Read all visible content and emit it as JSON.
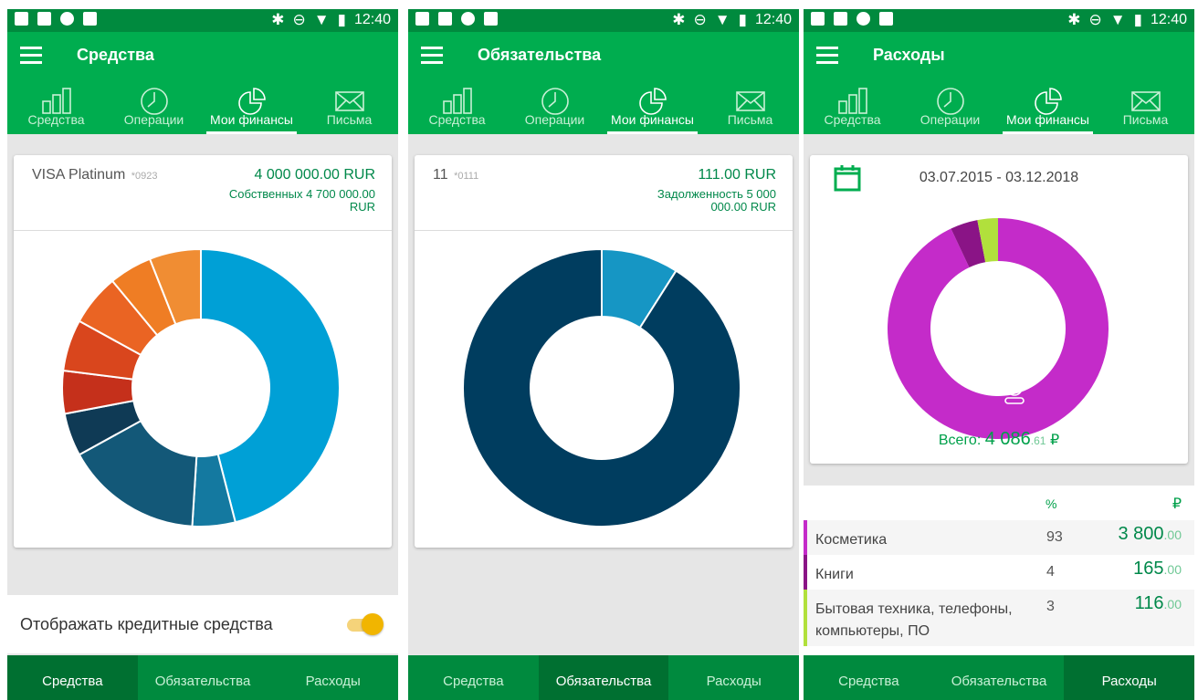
{
  "status_bar": {
    "time": "12:40"
  },
  "tabs": [
    "Средства",
    "Операции",
    "Мои финансы",
    "Письма"
  ],
  "bottom_nav": [
    "Средства",
    "Обязательства",
    "Расходы"
  ],
  "screens": {
    "assets": {
      "title": "Средства",
      "account": {
        "name": "VISA Platinum",
        "mask": "*0923",
        "amount": "4 000 000.00 RUR",
        "sub": "Собственных 4 700 000.00 RUR"
      },
      "toggle_label": "Отображать кредитные средства",
      "toggle_on": true
    },
    "liabilities": {
      "title": "Обязательства",
      "account": {
        "name": "11",
        "mask": "*0111",
        "amount": "111.00 RUR",
        "sub": "Задолженность 5 000 000.00 RUR"
      }
    },
    "expenses": {
      "title": "Расходы",
      "period": "03.07.2015 - 03.12.2018",
      "total_label": "Всего:",
      "total_main": "4 086",
      "total_cents": ".61",
      "currency": "₽",
      "col_pct": "%",
      "col_rub": "₽",
      "rows": [
        {
          "name": "Косметика",
          "pct": "93",
          "amount": "3 800",
          "cents": ".00",
          "color": "#c42bc9"
        },
        {
          "name": "Книги",
          "pct": "4",
          "amount": "165",
          "cents": ".00",
          "color": "#8a1486"
        },
        {
          "name": "Бытовая техника, телефоны, компьютеры, ПО",
          "pct": "3",
          "amount": "116",
          "cents": ".00",
          "color": "#b1e03c"
        }
      ]
    }
  },
  "chart_data": [
    {
      "type": "pie",
      "donut": true,
      "series": [
        {
          "values": [
            46,
            5,
            16,
            5,
            5,
            6,
            6,
            5,
            6
          ]
        }
      ],
      "colors": [
        "#00a0d6",
        "#1479a0",
        "#135878",
        "#0f3a55",
        "#c5301b",
        "#d9461d",
        "#ea6423",
        "#ef7d24",
        "#f08d33"
      ]
    },
    {
      "type": "pie",
      "donut": true,
      "series": [
        {
          "values": [
            9,
            91
          ]
        }
      ],
      "colors": [
        "#1696c4",
        "#003d5f"
      ]
    },
    {
      "type": "pie",
      "donut": true,
      "series": [
        {
          "values": [
            93,
            4,
            3
          ]
        }
      ],
      "colors": [
        "#c42bc9",
        "#8a1486",
        "#b1e03c"
      ]
    }
  ]
}
